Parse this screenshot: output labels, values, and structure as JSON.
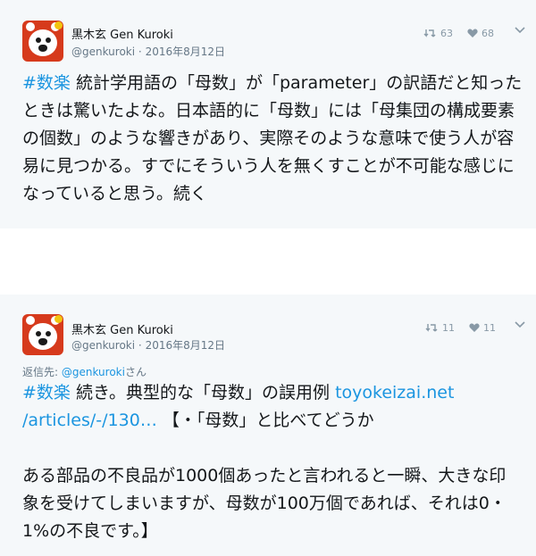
{
  "tweets": [
    {
      "display_name": "黒木玄 Gen Kuroki",
      "handle": "@genkuroki",
      "date": "2016年8月12日",
      "retweets": "63",
      "likes": "68",
      "hashtag": "#数楽",
      "text": " 統計学用語の「母数」が「parameter」の訳語だと知ったときは驚いたよな。日本語的に「母数」には「母集団の構成要素の個数」のような響きがあり、実際そのような意味で使う人が容易に見つかる。すでにそういう人を無くすことが不可能な感じになっていると思う。続く"
    },
    {
      "display_name": "黒木玄 Gen Kuroki",
      "handle": "@genkuroki",
      "date": "2016年8月12日",
      "retweets": "11",
      "likes": "11",
      "reply_prefix": "返信先: ",
      "reply_handle": "@genkuroki",
      "reply_suffix": "さん",
      "hashtag": "#数楽",
      "text_1": " 続き。典型的な「母数」の誤用例 ",
      "link_1": "toyokeizai.net",
      "link_2": "/articles/-/130…",
      "text_2": " 【・「母数」と比べてどうか",
      "text_3": "ある部品の不良品が1000個あったと言われると一瞬、大きな印象を受けてしまいますが、母数が100万個であれば、それは0・1%の不良です。】"
    }
  ],
  "icons": {
    "retweet": "retweet-icon",
    "like": "heart-icon",
    "menu": "chevron-down-icon",
    "avatar": "red-bear-avatar"
  },
  "colors": {
    "link": "#1b95e0",
    "muted": "#657786",
    "background": "#f5f8fa"
  }
}
